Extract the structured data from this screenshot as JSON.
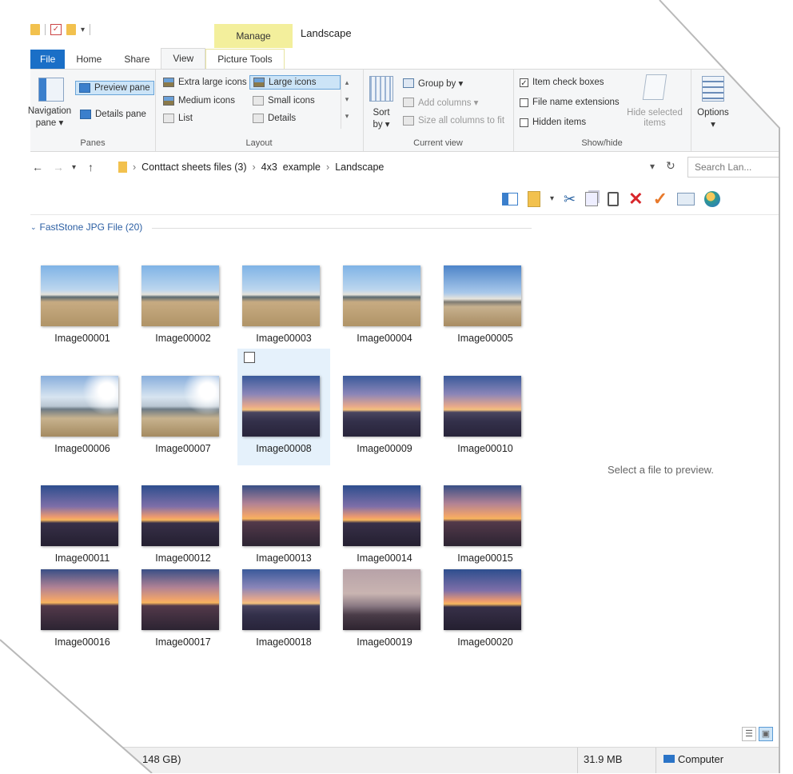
{
  "window": {
    "title": "Landscape",
    "contextual_tab": "Manage"
  },
  "tabs": [
    {
      "label": "File"
    },
    {
      "label": "Home"
    },
    {
      "label": "Share"
    },
    {
      "label": "View"
    },
    {
      "label": "Picture Tools"
    }
  ],
  "ribbon": {
    "panes": {
      "navigation_pane_line1": "Navigation",
      "navigation_pane_line2": "pane ▾",
      "preview_pane": "Preview pane",
      "details_pane": "Details pane",
      "label": "Panes"
    },
    "layout": {
      "extra_large_icons": "Extra large icons",
      "large_icons": "Large icons",
      "medium_icons": "Medium icons",
      "small_icons": "Small icons",
      "list": "List",
      "details": "Details",
      "label": "Layout"
    },
    "current_view": {
      "sort_by_line1": "Sort",
      "sort_by_line2": "by ▾",
      "group_by": "Group by ▾",
      "add_columns": "Add columns ▾",
      "size_all_columns": "Size all columns to fit",
      "label": "Current view"
    },
    "show_hide": {
      "item_check_boxes": "Item check boxes",
      "file_name_extensions": "File name extensions",
      "hidden_items": "Hidden items",
      "hide_selected_line1": "Hide selected",
      "hide_selected_line2": "items",
      "label": "Show/hide",
      "item_check_boxes_checked": true
    },
    "options": {
      "label": "Options",
      "arrow": "▾"
    }
  },
  "address": {
    "crumbs": [
      "Conttact sheets files (3)",
      "4x3  example",
      "Landscape"
    ],
    "search_placeholder": "Search Lan..."
  },
  "group_header": "FastStone JPG File (20)",
  "files": [
    {
      "name": "Image00001",
      "style": "day"
    },
    {
      "name": "Image00002",
      "style": "day"
    },
    {
      "name": "Image00003",
      "style": "day"
    },
    {
      "name": "Image00004",
      "style": "day"
    },
    {
      "name": "Image00005",
      "style": "day2"
    },
    {
      "name": "Image00006",
      "style": "glare"
    },
    {
      "name": "Image00007",
      "style": "glare"
    },
    {
      "name": "Image00008",
      "style": "sunset",
      "selected": true
    },
    {
      "name": "Image00009",
      "style": "sunset"
    },
    {
      "name": "Image00010",
      "style": "sunset"
    },
    {
      "name": "Image00011",
      "style": "sunset2"
    },
    {
      "name": "Image00012",
      "style": "sunset2"
    },
    {
      "name": "Image00013",
      "style": "orange"
    },
    {
      "name": "Image00014",
      "style": "sunset2"
    },
    {
      "name": "Image00015",
      "style": "orange"
    },
    {
      "name": "Image00016",
      "style": "orange"
    },
    {
      "name": "Image00017",
      "style": "orange"
    },
    {
      "name": "Image00018",
      "style": "sunset"
    },
    {
      "name": "Image00019",
      "style": "dusk"
    },
    {
      "name": "Image00020",
      "style": "sunset2"
    }
  ],
  "preview": {
    "message": "Select a file to preview."
  },
  "status_bar": {
    "free_space": "148 GB)",
    "size": "31.9 MB",
    "location": "Computer"
  }
}
